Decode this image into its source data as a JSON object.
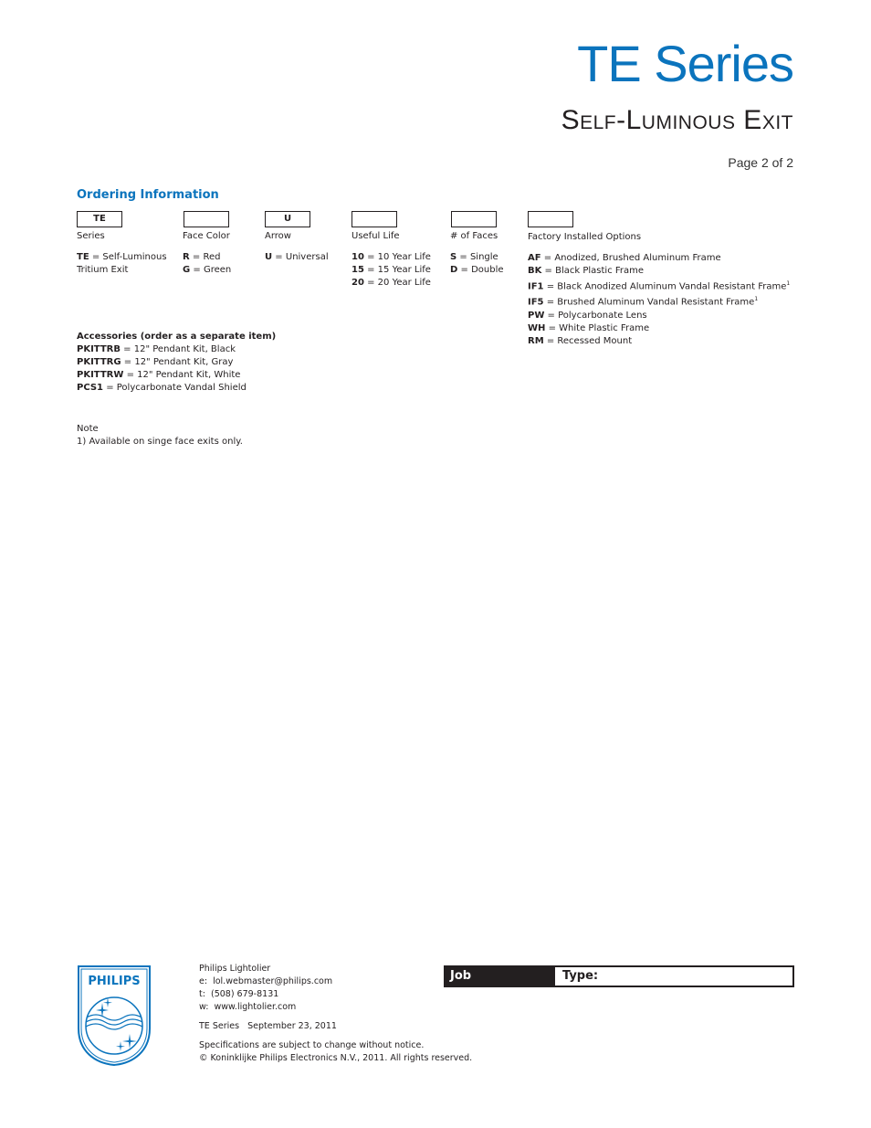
{
  "header": {
    "title": "TE Series",
    "subtitle": "Self-Luminous Exit",
    "page": "Page 2 of 2"
  },
  "ordering": {
    "title": "Ordering Information",
    "columns": [
      {
        "box": "TE",
        "label": "Series",
        "options": [
          {
            "code": "TE",
            "desc": "Self-Luminous"
          },
          {
            "code": "",
            "desc": "Tritium Exit"
          }
        ]
      },
      {
        "box": "",
        "label": "Face Color",
        "options": [
          {
            "code": "R",
            "desc": "Red"
          },
          {
            "code": "G",
            "desc": "Green"
          }
        ]
      },
      {
        "box": "U",
        "label": "Arrow",
        "options": [
          {
            "code": "U",
            "desc": "Universal"
          }
        ]
      },
      {
        "box": "",
        "label": "Useful Life",
        "options": [
          {
            "code": "10",
            "desc": "10 Year Life"
          },
          {
            "code": "15",
            "desc": "15 Year Life"
          },
          {
            "code": "20",
            "desc": "20 Year Life"
          }
        ]
      },
      {
        "box": "",
        "label": "# of Faces",
        "options": [
          {
            "code": "S",
            "desc": "Single"
          },
          {
            "code": "D",
            "desc": "Double"
          }
        ]
      },
      {
        "box": "",
        "label": "Factory Installed Options",
        "options": [
          {
            "code": "AF",
            "desc": "Anodized, Brushed Aluminum Frame"
          },
          {
            "code": "BK",
            "desc": "Black Plastic Frame"
          },
          {
            "code": "IF1",
            "desc": "Black Anodized Aluminum Vandal Resistant Frame",
            "sup": "1"
          },
          {
            "code": "IF5",
            "desc": "Brushed Aluminum Vandal Resistant Frame",
            "sup": "1"
          },
          {
            "code": "PW",
            "desc": "Polycarbonate Lens"
          },
          {
            "code": "WH",
            "desc": "White Plastic Frame"
          },
          {
            "code": "RM",
            "desc": "Recessed Mount"
          }
        ]
      }
    ]
  },
  "accessories": {
    "title": "Accessories (order as a separate item)",
    "items": [
      {
        "code": "PKITTRB",
        "desc": "12\" Pendant Kit, Black"
      },
      {
        "code": "PKITTRG",
        "desc": "12\" Pendant Kit, Gray"
      },
      {
        "code": "PKITTRW",
        "desc": "12\" Pendant Kit, White"
      },
      {
        "code": "PCS1",
        "desc": "Polycarbonate Vandal Shield"
      }
    ]
  },
  "note": {
    "title": "Note",
    "text": "1) Available on singe face exits only."
  },
  "footer": {
    "logo_text": "PHILIPS",
    "company": "Philips Lightolier",
    "email_label": "e:",
    "email": "lol.webmaster@philips.com",
    "phone_label": "t:",
    "phone": "(508) 679-8131",
    "web_label": "w:",
    "web": "www.lightolier.com",
    "series": "TE Series",
    "date": "September 23, 2011",
    "disclaimer": "Specifications are subject to change without notice.",
    "copyright": "© Koninklijke Philips Electronics N.V., 2011. All rights reserved.",
    "job_label": "Job Information",
    "type_label": "Type:",
    "type_value": ""
  },
  "colors": {
    "brand_blue": "#0b74bd",
    "text": "#231f20"
  }
}
